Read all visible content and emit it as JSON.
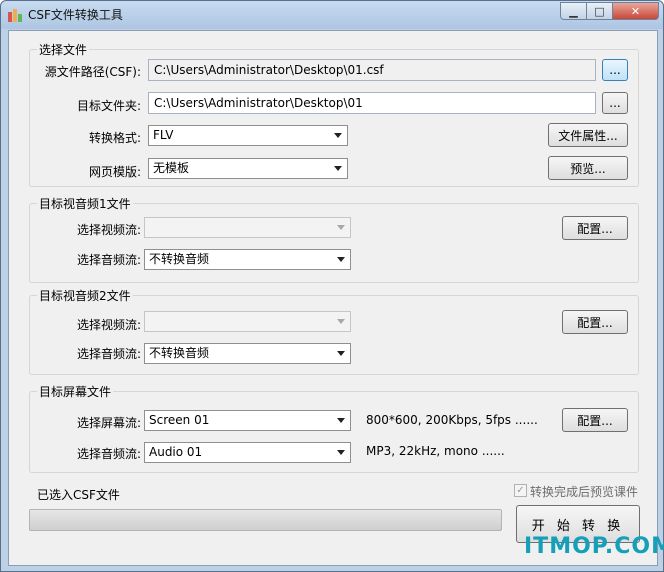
{
  "window": {
    "title": "CSF文件转换工具"
  },
  "source_group": {
    "title": "选择文件",
    "source_label": "源文件路径(CSF):",
    "source_value": "C:\\Users\\Administrator\\Desktop\\01.csf",
    "target_label": "目标文件夹:",
    "target_value": "C:\\Users\\Administrator\\Desktop\\01",
    "browse_label": "...",
    "format_label": "转换格式:",
    "format_value": "FLV",
    "file_props_label": "文件属性...",
    "template_label": "网页模版:",
    "template_value": "无模板",
    "preview_label": "预览..."
  },
  "av1_group": {
    "title": "目标视音频1文件",
    "video_label": "选择视频流:",
    "video_value": "",
    "audio_label": "选择音频流:",
    "audio_value": "不转换音频",
    "config_label": "配置..."
  },
  "av2_group": {
    "title": "目标视音频2文件",
    "video_label": "选择视频流:",
    "video_value": "",
    "audio_label": "选择音频流:",
    "audio_value": "不转换音频",
    "config_label": "配置..."
  },
  "screen_group": {
    "title": "目标屏幕文件",
    "screen_label": "选择屏幕流:",
    "screen_value": "Screen 01",
    "screen_info": "800*600, 200Kbps, 5fps ......",
    "audio_label": "选择音频流:",
    "audio_value": "Audio 01",
    "audio_info": "MP3, 22kHz, mono ......",
    "config_label": "配置..."
  },
  "bottom": {
    "status_label": "已选入CSF文件",
    "progress": 0,
    "preview_after_label": "转换完成后预览课件",
    "preview_after_checked": true,
    "start_label": "开 始 转 换"
  },
  "watermark": "ITMOP.COM",
  "colors": {
    "titlebar": "#aec6e3",
    "client": "#f0f0f0",
    "progress_fill": "#3fb02a",
    "watermark": "#14a0b8"
  }
}
